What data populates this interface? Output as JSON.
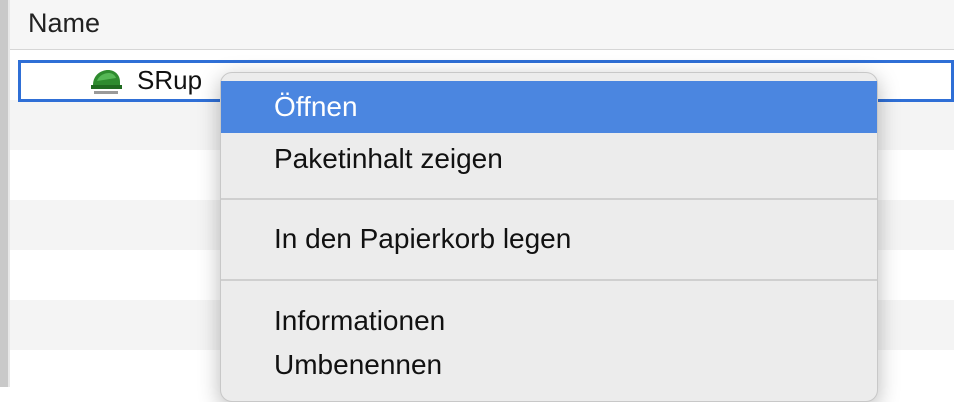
{
  "header": {
    "name_column": "Name"
  },
  "file": {
    "name": "SRup",
    "icon": "app-icon"
  },
  "context_menu": {
    "items": [
      {
        "label": "Öffnen",
        "highlighted": true
      },
      {
        "label": "Paketinhalt zeigen",
        "highlighted": false
      },
      {
        "label": "In den Papierkorb legen",
        "highlighted": false
      },
      {
        "label": "Informationen",
        "highlighted": false
      },
      {
        "label": "Umbenennen",
        "highlighted": false
      }
    ]
  },
  "colors": {
    "selection": "#2f6fd6",
    "highlight": "#4b86e0",
    "menu_bg": "#ececec"
  }
}
